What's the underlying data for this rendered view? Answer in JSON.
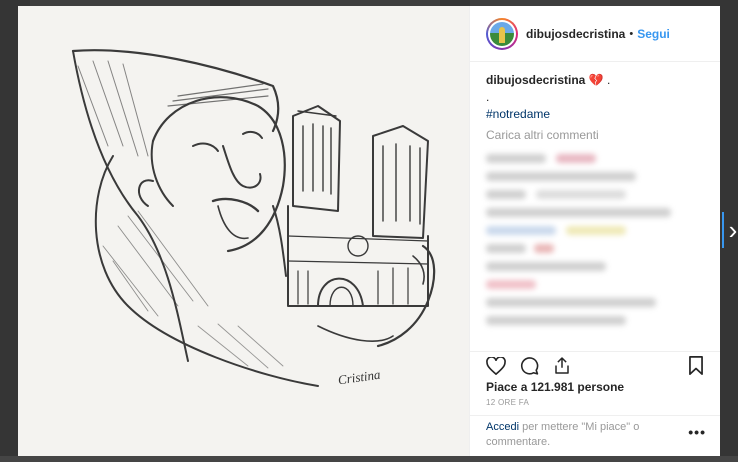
{
  "post": {
    "username": "dibujosdecristina",
    "follow_label": "Segui",
    "separator": "•",
    "caption_user": "dibujosdecristina",
    "caption_emoji": "💔",
    "caption_trail": " .",
    "caption_dot": ".",
    "hashtag": "#notredame",
    "load_more": "Carica altri commenti",
    "likes": "Piace a 121.981 persone",
    "time": "12 ORE FA",
    "login_link": "Accedi",
    "login_text": " per mettere \"Mi piace\" o commentare.",
    "more_label": "•••",
    "artwork_signature": "Cristina"
  },
  "nav": {
    "next_glyph": "›"
  },
  "colors": {
    "accent": "#3897f0",
    "heart": "#d0253f",
    "text": "#262626",
    "muted": "#999999"
  },
  "icons": [
    "heart-icon",
    "comment-icon",
    "share-icon",
    "bookmark-icon"
  ]
}
